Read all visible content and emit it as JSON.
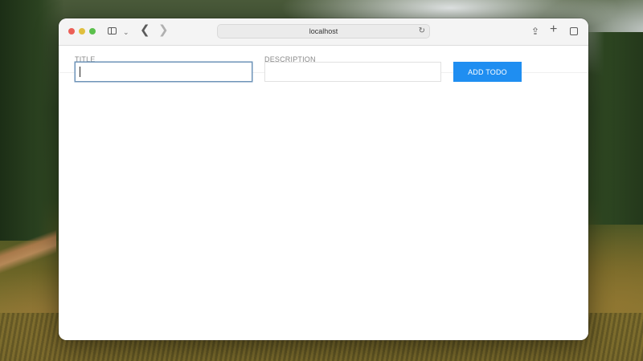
{
  "browser": {
    "url": "localhost"
  },
  "form": {
    "title_header": "TITLE",
    "description_header": "DESCRIPTION",
    "title_value": "",
    "description_value": "",
    "add_button_label": "ADD TODO"
  },
  "colors": {
    "accent": "#1f8ef1",
    "focus_border": "#6d93b8"
  }
}
